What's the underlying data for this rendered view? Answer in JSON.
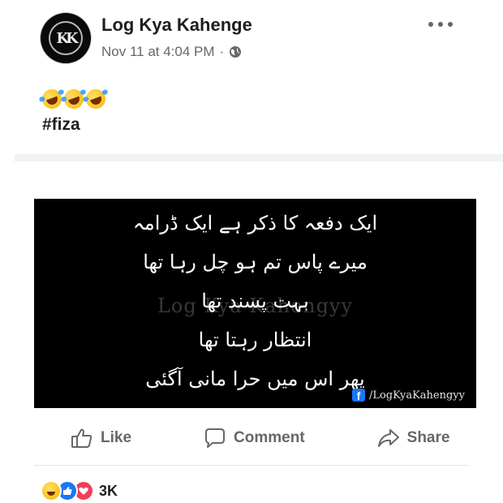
{
  "post": {
    "page_name": "Log Kya Kahenge",
    "avatar_text": "KK",
    "timestamp": "Nov 11 at 4:04 PM",
    "separator": "·",
    "audience_icon": "globe-icon",
    "more_icon": "more-options-icon",
    "caption_emojis": [
      "laughing-emoji",
      "laughing-emoji",
      "laughing-emoji"
    ],
    "hashtag": "#fiza"
  },
  "image": {
    "lines": [
      "ایک دفعہ کا ذکر ہے ایک ڈرامہ",
      "میرے پاس تم ہو چل رہا تھا",
      "بہت پسند تھا",
      "انتظار رہتا تھا",
      "پھر اس میں حرا مانی آگئی"
    ],
    "watermark": "Log Kya Kahengyy",
    "credit": "/LogKyaKahengyy",
    "credit_icon": "facebook-icon"
  },
  "actions": {
    "like": "Like",
    "comment": "Comment",
    "share": "Share"
  },
  "reactions": {
    "icons": [
      "haha-reaction",
      "like-reaction",
      "love-reaction"
    ],
    "count": "3K"
  },
  "colors": {
    "brand_blue": "#1877f2",
    "love_red": "#f33e58",
    "muted_text": "#65676b"
  }
}
